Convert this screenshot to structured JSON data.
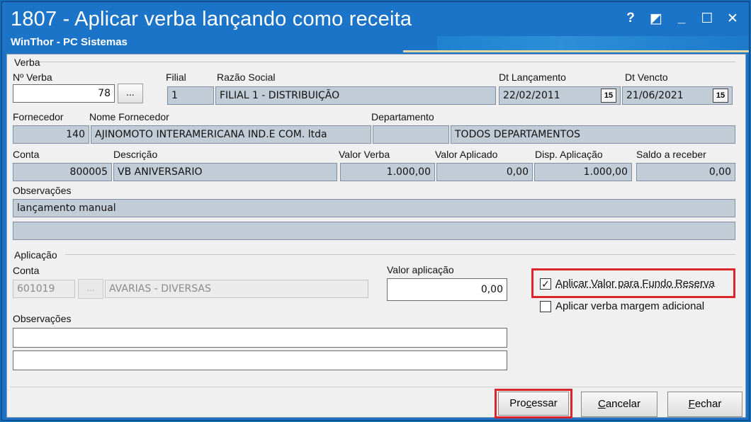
{
  "window": {
    "title": "1807 - Aplicar verba lançando como receita",
    "subtitle": "WinThor - PC Sistemas",
    "controls": {
      "help": "?",
      "restore": "◩",
      "minimize": "_",
      "maximize": "☐",
      "close": "✕"
    }
  },
  "verba": {
    "group_label": "Verba",
    "num_verba_label": "Nº Verba",
    "num_verba": "78",
    "dots": "...",
    "filial_label": "Filial",
    "filial": "1",
    "razao_label": "Razão Social",
    "razao": "FILIAL 1 - DISTRIBUIÇÃO",
    "dt_lanc_label": "Dt Lançamento",
    "dt_lanc": "22/02/2011",
    "dt_venc_label": "Dt Vencto",
    "dt_venc": "21/06/2021",
    "cal_icon": "15",
    "fornecedor_label": "Fornecedor",
    "fornecedor": "140",
    "nome_forn_label": "Nome Fornecedor",
    "nome_forn": "AJINOMOTO INTERAMERICANA IND.E COM. ltda",
    "depto_label": "Departamento",
    "depto_code": "",
    "depto": "TODOS DEPARTAMENTOS",
    "conta_label": "Conta",
    "conta": "800005",
    "descricao_label": "Descrição",
    "descricao": "VB ANIVERSARIO",
    "valor_verba_label": "Valor Verba",
    "valor_verba": "1.000,00",
    "valor_aplicado_label": "Valor Aplicado",
    "valor_aplicado": "0,00",
    "disp_label": "Disp. Aplicação",
    "disp": "1.000,00",
    "saldo_label": "Saldo a receber",
    "saldo": "0,00",
    "obs_label": "Observações",
    "obs1": "lançamento manual",
    "obs2": ""
  },
  "aplicacao": {
    "group_label": "Aplicação",
    "conta_label": "Conta",
    "conta": "601019",
    "dots": "...",
    "conta_desc": "AVARIAS - DIVERSAS",
    "valor_label": "Valor aplicação",
    "valor": "0,00",
    "obs_label": "Observações",
    "obs1": "",
    "obs2": "",
    "chk_fundo_label": "Aplicar Valor para Fundo Reserva",
    "chk_fundo_checked": true,
    "chk_margem_label": "Aplicar verba margem adicional",
    "chk_margem_checked": false
  },
  "buttons": {
    "processar_pre": "Pro",
    "processar_key": "c",
    "processar_post": "essar",
    "cancelar_key": "C",
    "cancelar_post": "ancelar",
    "fechar_key": "F",
    "fechar_post": "echar"
  },
  "colors": {
    "titlebar": "#1b74c7",
    "highlight": "#d9252b",
    "readonly_field": "#c2ccd6"
  }
}
